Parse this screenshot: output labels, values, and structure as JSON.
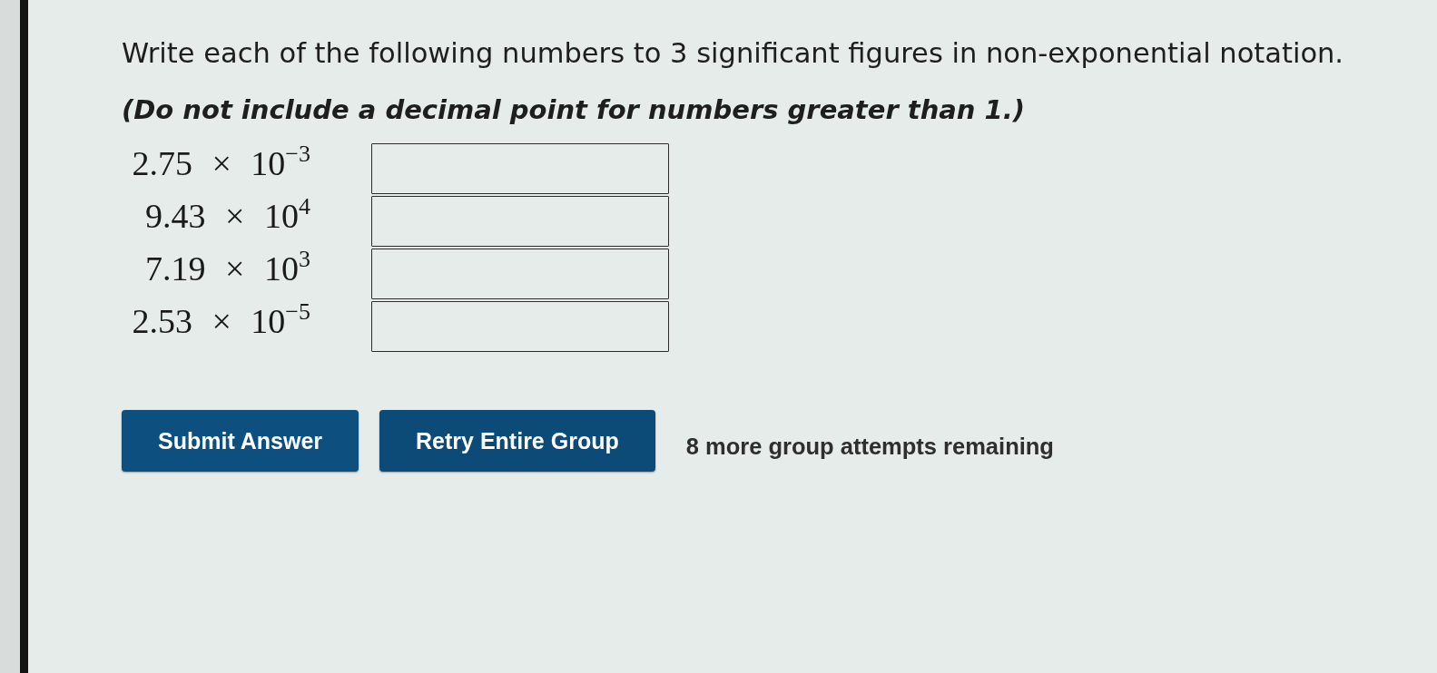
{
  "question": {
    "instruction": "Write each of the following numbers to 3 significant figures in non-exponential notation.",
    "note": "(Do not include a decimal point for numbers greater than 1.)"
  },
  "items": [
    {
      "number": "2.75 × 10$^{−3}$"
    },
    {
      "number": "9.43 × 10$^{4}$"
    },
    {
      "number": "7.19 × 10$^{3}$"
    },
    {
      "number": "2.53 × 10$^{−5}$"
    }
  ],
  "buttons": [
    {
      "kind": "submit",
      "label": "Submit Answer"
    },
    {
      "kind": "retry",
      "label": "Retry Entire Group"
    }
  ],
  "attempts": "8 more group attempts remaining"
}
